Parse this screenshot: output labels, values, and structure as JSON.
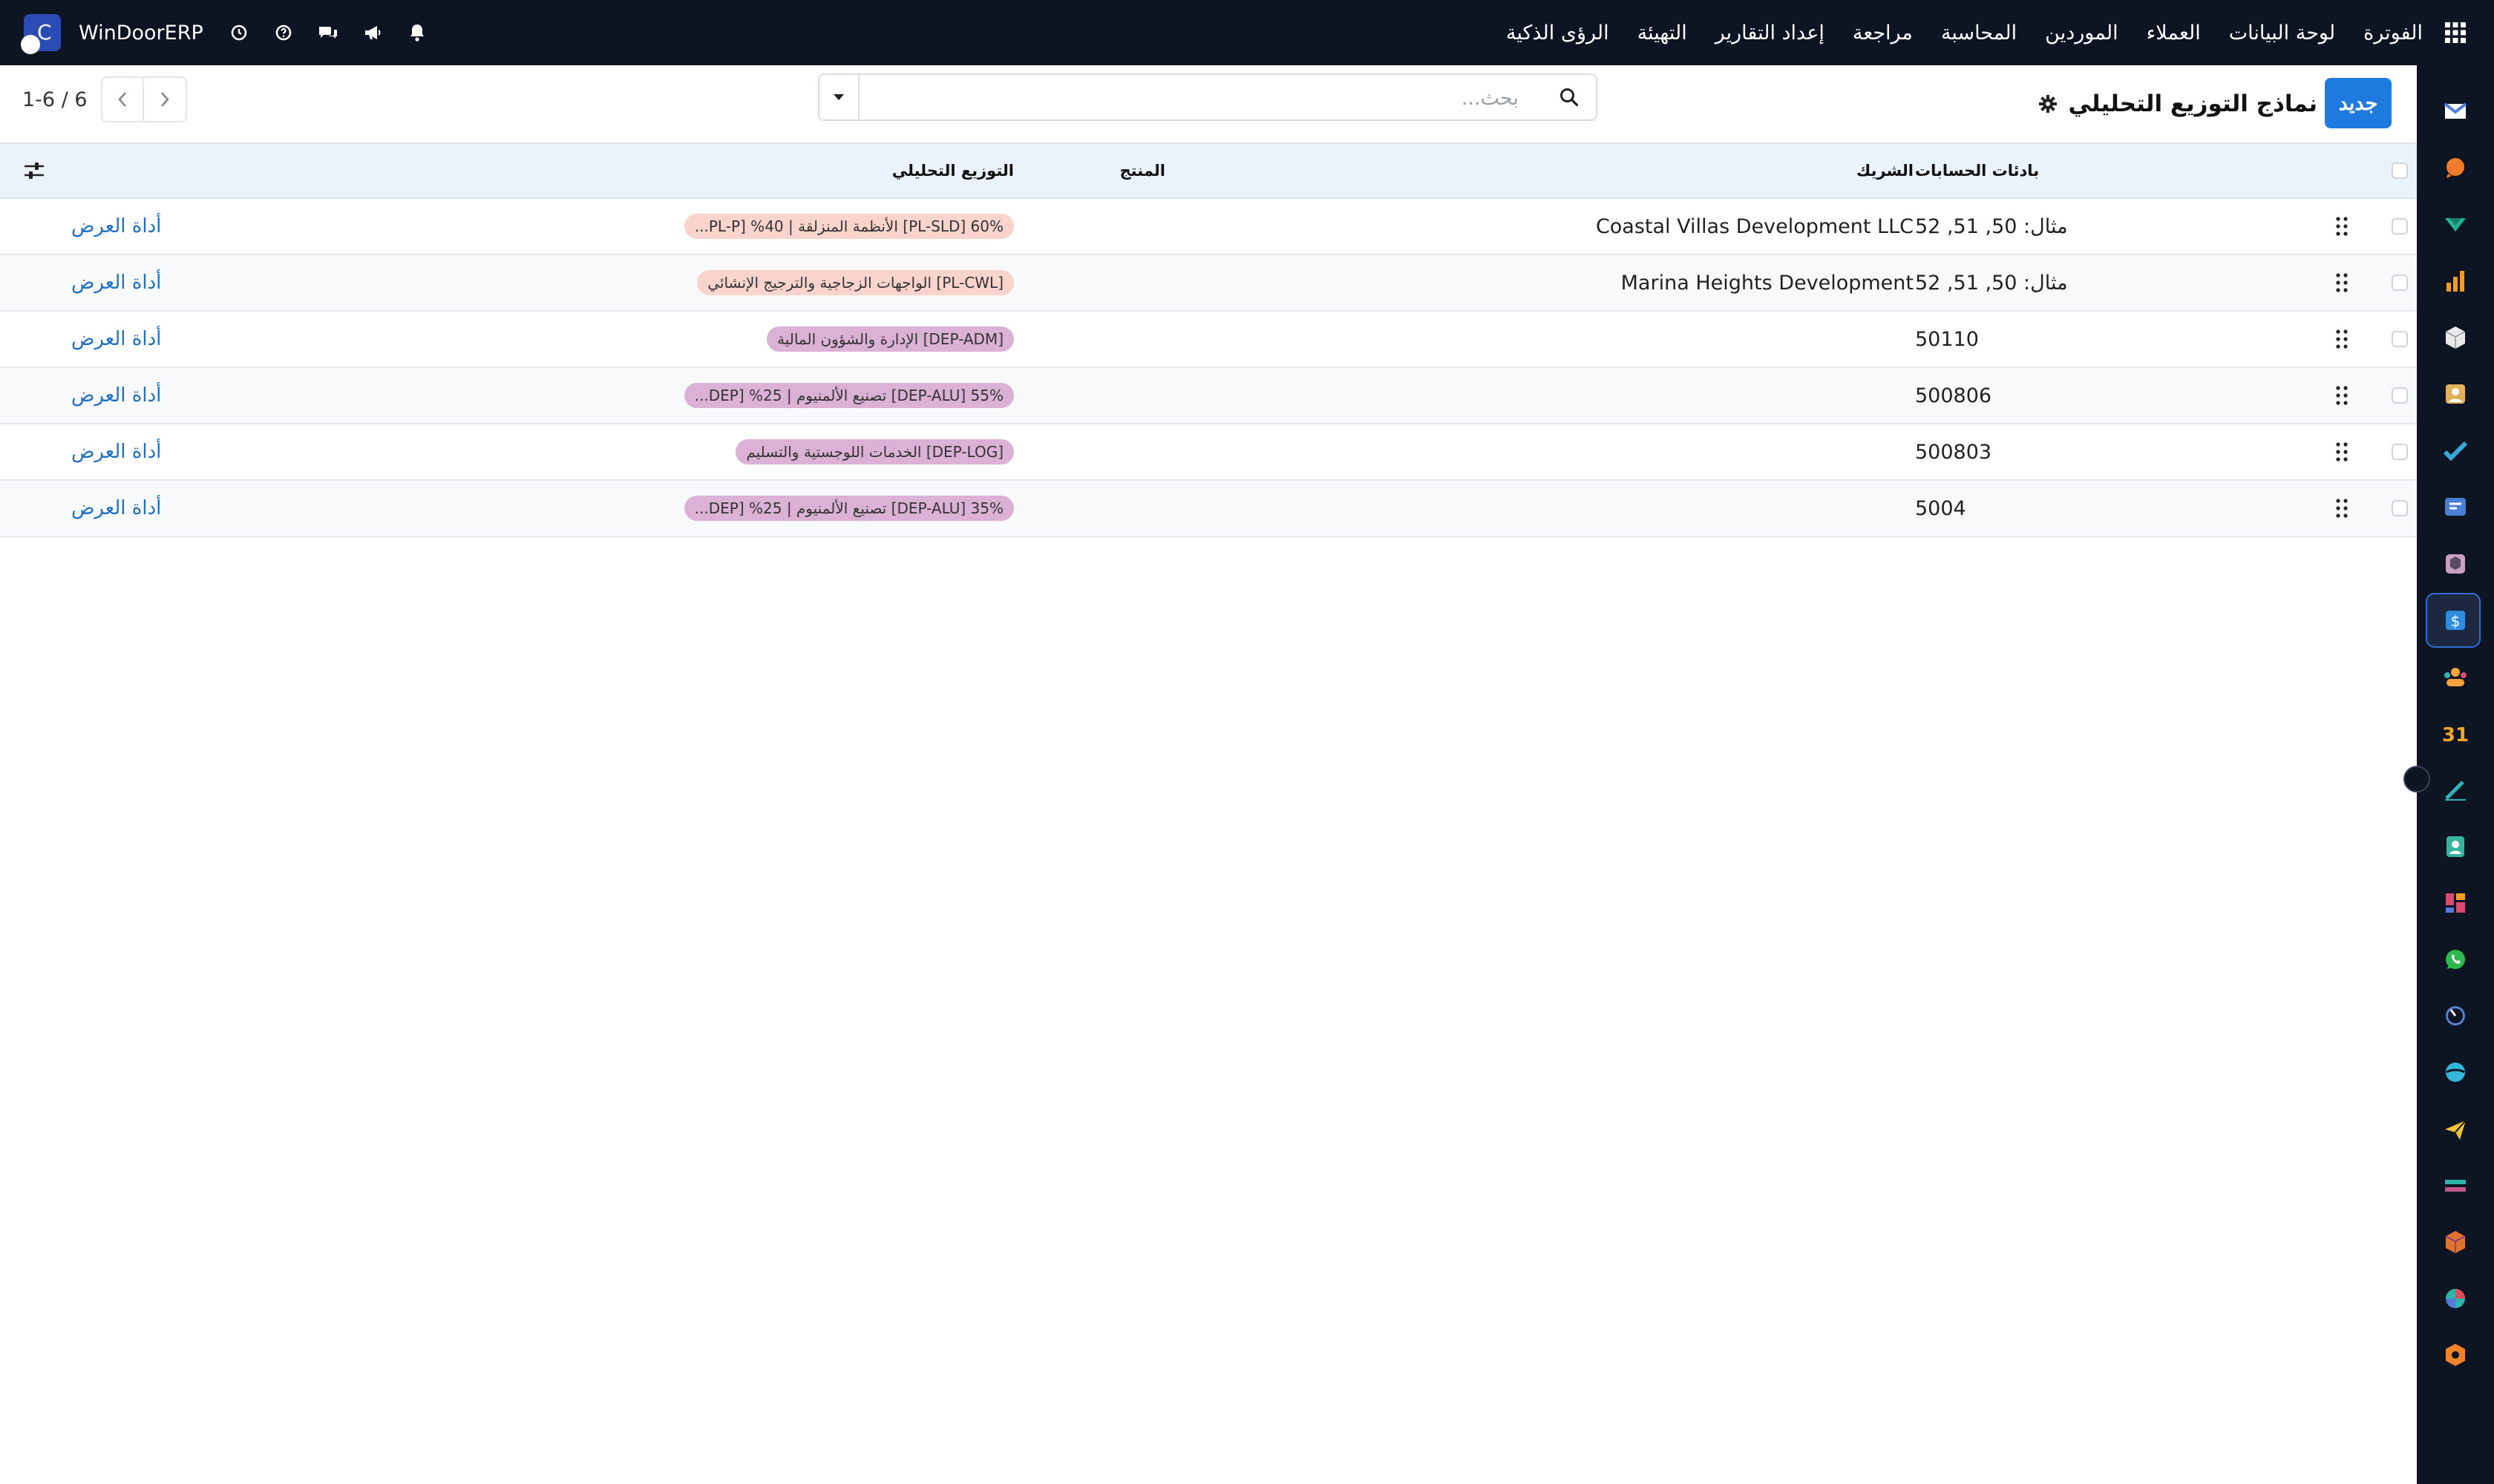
{
  "navbar": {
    "brand": "WinDoorERP",
    "apps_icon": "grid-icon",
    "menu": [
      "الفوترة",
      "لوحة البيانات",
      "العملاء",
      "الموردين",
      "المحاسبة",
      "مراجعة",
      "إعداد التقارير",
      "التهيئة",
      "الرؤى الذكية"
    ],
    "icons": [
      "clock-icon",
      "help-icon",
      "chat-icon",
      "megaphone-icon",
      "bell-icon"
    ]
  },
  "control_panel": {
    "new_button": "جديد",
    "title": "نماذج التوزيع التحليلي",
    "settings_icon": "gear-icon",
    "search_placeholder": "بحث...",
    "pager_value": "1-6",
    "pager_sep": " / ",
    "pager_total": "6"
  },
  "columns": {
    "accounts": "بادئات الحسابات",
    "partner": "الشريك",
    "product": "المنتج",
    "distribution": "التوزيع التحليلي"
  },
  "rows": [
    {
      "accounts": "مثال: 50, 51, 52",
      "partner": "Coastal Villas Development LLC",
      "product": "",
      "distribution": "60% [PL-SLD] الأنظمة المنزلقة | 40% [PL-P...",
      "tag_color": "#f8d4cd",
      "action": "أداة العرض"
    },
    {
      "accounts": "مثال: 50, 51, 52",
      "partner": "Marina Heights Development",
      "product": "",
      "distribution": "[PL-CWL] الواجهات الزجاجية والترجيج الإنشائي",
      "tag_color": "#f8d4cd",
      "action": "أداة العرض"
    },
    {
      "accounts": "50110",
      "partner": "",
      "product": "",
      "distribution": "[DEP-ADM] الإدارة والشؤون المالية",
      "tag_color": "#dcb1d6",
      "action": "أداة العرض"
    },
    {
      "accounts": "500806",
      "partner": "",
      "product": "",
      "distribution": "55% [DEP-ALU] تصنيع الألمنيوم | 25% [DEP...",
      "tag_color": "#dcb1d6",
      "action": "أداة العرض"
    },
    {
      "accounts": "500803",
      "partner": "",
      "product": "",
      "distribution": "[DEP-LOG] الخدمات اللوجستية والتسليم",
      "tag_color": "#dcb1d6",
      "action": "أداة العرض"
    },
    {
      "accounts": "5004",
      "partner": "",
      "product": "",
      "distribution": "35% [DEP-ALU] تصنيع الألمنيوم | 25% [DEP...",
      "tag_color": "#dcb1d6",
      "action": "أداة العرض"
    }
  ],
  "sidebar_apps": [
    {
      "icon": "gmail-icon",
      "color": "#4f7bd9"
    },
    {
      "icon": "discuss-icon",
      "color": "#f07b2a"
    },
    {
      "icon": "crm-icon",
      "color": "#1fb58f"
    },
    {
      "icon": "reports-icon",
      "color": "#f29c25"
    },
    {
      "icon": "inventory-icon",
      "color": "#e8e8e8"
    },
    {
      "icon": "photo-icon",
      "color": "#e0b15a"
    },
    {
      "icon": "check-icon",
      "color": "#3aa7d8"
    },
    {
      "icon": "chat-window-icon",
      "color": "#4a7fd6"
    },
    {
      "icon": "box-icon",
      "color": "#c9a0c4"
    },
    {
      "icon": "accounting-icon",
      "color": "#2f8de0",
      "active": true
    },
    {
      "icon": "employees-icon",
      "color": "#f3a33a"
    },
    {
      "icon": "calendar-icon",
      "color": "#f2a72b"
    },
    {
      "icon": "sign-icon",
      "color": "#2eb3b8"
    },
    {
      "icon": "contacts-icon",
      "color": "#35b4a0"
    },
    {
      "icon": "dashboard-icon",
      "color": "#d94c6f"
    },
    {
      "icon": "whatsapp-icon",
      "color": "#2fb84f"
    },
    {
      "icon": "timer-icon",
      "color": "#5b7fd4"
    },
    {
      "icon": "website-icon",
      "color": "#34b6d9"
    },
    {
      "icon": "send-icon",
      "color": "#f1c232"
    },
    {
      "icon": "stripe-icon",
      "color": "#c5568a"
    },
    {
      "icon": "cube-icon",
      "color": "#e0732b"
    },
    {
      "icon": "pie-icon",
      "color": "#e24b5c"
    },
    {
      "icon": "hexagon-icon",
      "color": "#f0832a"
    }
  ]
}
